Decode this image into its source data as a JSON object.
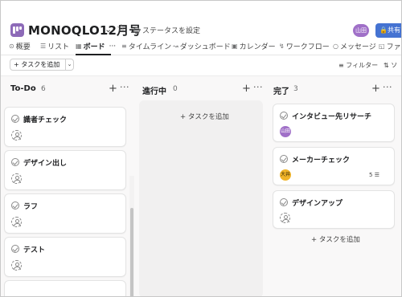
{
  "header": {
    "project_title": "MONOQLO12月号",
    "set_status_label": "ステータスを設定",
    "user_avatar_initials": "山田",
    "share_label": "共有"
  },
  "tabs": [
    {
      "label": "概要",
      "icon": "overview-icon"
    },
    {
      "label": "リスト",
      "icon": "list-icon"
    },
    {
      "label": "ボード",
      "icon": "board-icon",
      "active": true,
      "more": "···"
    },
    {
      "label": "タイムライン",
      "icon": "timeline-icon"
    },
    {
      "label": "ダッシュボード",
      "icon": "dashboard-icon"
    },
    {
      "label": "カレンダー",
      "icon": "calendar-icon"
    },
    {
      "label": "ワークフロー",
      "icon": "workflow-icon"
    },
    {
      "label": "メッセージ",
      "icon": "message-icon"
    },
    {
      "label": "ファ",
      "icon": "file-icon"
    }
  ],
  "toolbar": {
    "add_task_label": "+ タスクを追加",
    "filter_label": "フィルター",
    "sort_label": "ソ"
  },
  "columns": [
    {
      "title": "To-Do",
      "count": "6",
      "cards": [
        {
          "name": "識者チェック"
        },
        {
          "name": "デザイン出し"
        },
        {
          "name": "ラフ"
        },
        {
          "name": "テスト"
        }
      ]
    },
    {
      "title": "進行中",
      "count": "0",
      "add_task_label": "+ タスクを追加"
    },
    {
      "title": "完了",
      "count": "3",
      "cards": [
        {
          "name": "インタビュー先リサーチ",
          "assignee": "山田",
          "assignee_color": "#a070c8"
        },
        {
          "name": "メーカーチェック",
          "assignee": "大井",
          "assignee_color": "#f0b429",
          "subtask_count": "5"
        },
        {
          "name": "デザインアップ"
        }
      ],
      "add_task_label": "+ タスクを追加"
    }
  ],
  "colors": {
    "accent": "#4573d2",
    "project_icon": "#8d6ab8"
  }
}
